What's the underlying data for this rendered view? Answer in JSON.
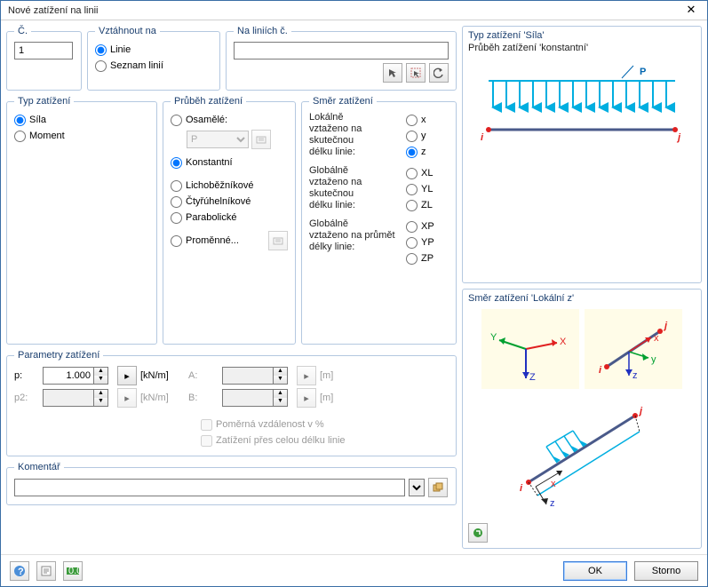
{
  "window": {
    "title": "Nové zatížení na linii"
  },
  "fs_c": {
    "legend": "Č.",
    "value": "1"
  },
  "fs_vz": {
    "legend": "Vztáhnout na",
    "opt_linie": "Linie",
    "opt_seznam": "Seznam linií"
  },
  "fs_lin": {
    "legend": "Na liniích č.",
    "value": ""
  },
  "fs_typ": {
    "legend": "Typ zatížení",
    "opt_sila": "Síla",
    "opt_moment": "Moment"
  },
  "fs_prub": {
    "legend": "Průběh zatížení",
    "opt_osamele": "Osamělé:",
    "combo_p": "P",
    "opt_konst": "Konstantní",
    "opt_licho": "Lichoběžníkové",
    "opt_ctyru": "Čtyřúhelníkové",
    "opt_parab": "Parabolické",
    "opt_prom": "Proměnné..."
  },
  "fs_smer": {
    "legend": "Směr zatížení",
    "local_label": "Lokálně\nvztaženo na skutečnou\ndélku linie:",
    "global_real_label": "Globálně\nvztaženo na skutečnou\ndélku linie:",
    "global_proj_label": "Globálně\nvztaženo na průmět\ndélky linie:",
    "x": "x",
    "y": "y",
    "z": "z",
    "XL": "XL",
    "YL": "YL",
    "ZL": "ZL",
    "XP": "XP",
    "YP": "YP",
    "ZP": "ZP"
  },
  "fs_param": {
    "legend": "Parametry zatížení",
    "p_label": "p:",
    "p_value": "1.000",
    "p_unit": "[kN/m]",
    "p2_label": "p2:",
    "p2_value": "",
    "p2_unit": "[kN/m]",
    "a_label": "A:",
    "a_value": "",
    "a_unit": "[m]",
    "b_label": "B:",
    "b_value": "",
    "b_unit": "[m]",
    "chk_rel": "Poměrná vzdálenost v %",
    "chk_full": "Zatížení přes celou délku linie"
  },
  "fs_kom": {
    "legend": "Komentář",
    "value": ""
  },
  "preview1": {
    "title": "Typ zatížení 'Síla'",
    "sub": "Průběh zatížení 'konstantní'"
  },
  "preview2": {
    "title": "Směr zatížení 'Lokální z'"
  },
  "buttons": {
    "ok": "OK",
    "cancel": "Storno"
  }
}
